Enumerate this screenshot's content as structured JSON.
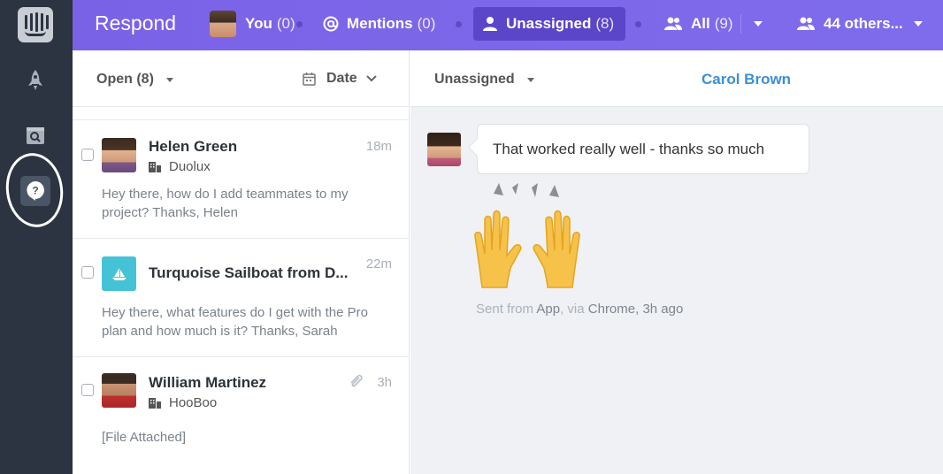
{
  "topbar": {
    "title": "Respond",
    "tabs": [
      {
        "label": "You",
        "count": "(0)"
      },
      {
        "label": "Mentions",
        "count": "(0)"
      },
      {
        "label": "Unassigned",
        "count": "(8)",
        "active": true
      },
      {
        "label": "All",
        "count": "(9)"
      },
      {
        "label": "44 others..."
      }
    ]
  },
  "list": {
    "status_filter": "Open (8)",
    "sort_label": "Date",
    "conversations": [
      {
        "name": "Helen Green",
        "company": "Duolux",
        "time": "18m",
        "preview": "Hey there, how do I add teammates to my project? Thanks, Helen"
      },
      {
        "name": "Turquoise Sailboat from D...",
        "time": "22m",
        "preview": "Hey there, what features do I get with the Pro plan and how much is it? Thanks, Sarah"
      },
      {
        "name": "William Martinez",
        "company": "HooBoo",
        "time": "3h",
        "preview": "[File Attached]"
      }
    ]
  },
  "pane": {
    "assignee": "Unassigned",
    "customer": "Carol Brown",
    "message": "That worked really well - thanks so much",
    "meta_prefix": "Sent from",
    "meta_app": "App",
    "meta_via": ", via",
    "meta_browser": "Chrome",
    "meta_time": ", 3h ago"
  },
  "colors": {
    "topbar": "#7a62e6",
    "active_tab": "#5b46c9",
    "rail": "#2b3440",
    "link": "#3b8fd8"
  }
}
